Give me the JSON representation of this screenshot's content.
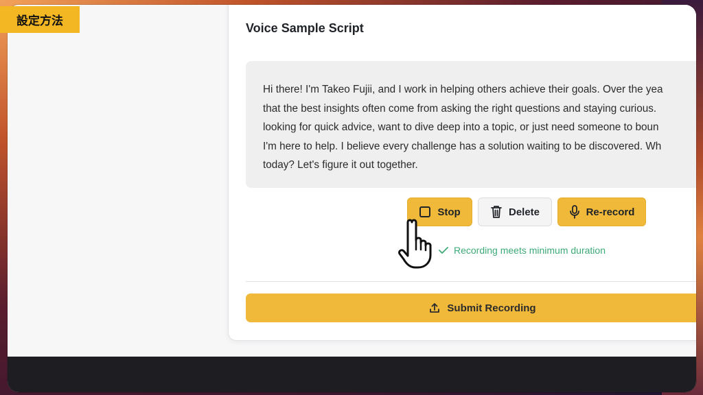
{
  "badge": {
    "label": "設定方法"
  },
  "card": {
    "title": "Voice Sample Script",
    "script_lines": [
      "Hi there! I'm Takeo Fujii, and I work in helping others achieve their goals. Over the yea",
      "that the best insights often come from asking the right questions and staying curious.",
      "looking for quick advice, want to dive deep into a topic, or just need someone to boun",
      "I'm here to help. I believe every challenge has a solution waiting to be discovered. Wh",
      "today? Let's figure it out together."
    ]
  },
  "controls": {
    "stop_label": "Stop",
    "delete_label": "Delete",
    "rerecord_label": "Re-record"
  },
  "status": {
    "text": "Recording meets minimum duration"
  },
  "submit": {
    "label": "Submit Recording"
  },
  "icons": {
    "stop": "stop-square-icon",
    "delete": "trash-icon",
    "rerecord": "microphone-icon",
    "status": "check-icon",
    "submit": "upload-icon",
    "cursor": "pointer-hand-cursor"
  },
  "colors": {
    "accent": "#f0b93a",
    "badge": "#f3b724",
    "success": "#3daa78"
  }
}
